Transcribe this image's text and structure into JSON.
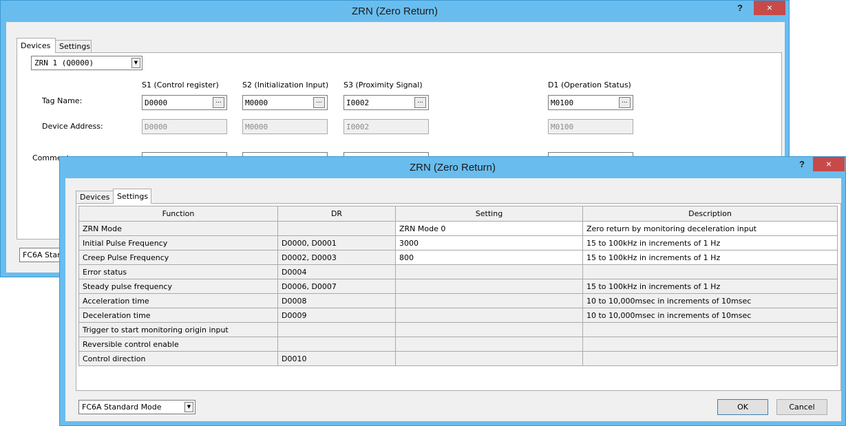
{
  "back_window": {
    "title": "ZRN (Zero Return)",
    "help_label": "?",
    "close_label": "×",
    "tabs": [
      {
        "label": "Devices"
      },
      {
        "label": "Settings"
      }
    ],
    "instance_select": "ZRN 1 (Q0000)",
    "columns": [
      "S1 (Control register)",
      "S2 (Initialization Input)",
      "S3 (Proximity Signal)",
      "D1 (Operation Status)"
    ],
    "row_labels": {
      "tag_name": "Tag Name:",
      "device_address": "Device Address:",
      "comment": "Comment:"
    },
    "tag_names": [
      "D0000",
      "M0000",
      "I0002",
      "M0100"
    ],
    "device_addresses": [
      "D0000",
      "M0000",
      "I0002",
      "M0100"
    ],
    "browse_label": "...",
    "mode_select": "FC6A Standard Mode"
  },
  "front_window": {
    "title": "ZRN (Zero Return)",
    "help_label": "?",
    "close_label": "×",
    "tabs": [
      {
        "label": "Devices"
      },
      {
        "label": "Settings"
      }
    ],
    "table": {
      "headers": [
        "Function",
        "DR",
        "Setting",
        "Description"
      ],
      "rows": [
        [
          "ZRN Mode",
          "",
          "ZRN Mode 0",
          "Zero return by monitoring deceleration input"
        ],
        [
          "Initial Pulse Frequency",
          "D0000, D0001",
          "3000",
          "15 to 100kHz in increments of 1 Hz"
        ],
        [
          "Creep Pulse Frequency",
          "D0002, D0003",
          "800",
          "15 to 100kHz in increments of 1 Hz"
        ],
        [
          "Error status",
          "D0004",
          "",
          ""
        ],
        [
          "Steady pulse frequency",
          "D0006, D0007",
          "",
          "15 to 100kHz in increments of 1 Hz"
        ],
        [
          "Acceleration time",
          "D0008",
          "",
          "10 to 10,000msec in increments of 10msec"
        ],
        [
          "Deceleration time",
          "D0009",
          "",
          "10 to 10,000msec in increments of 10msec"
        ],
        [
          "Trigger to start monitoring origin input",
          "",
          "",
          ""
        ],
        [
          "Reversible control enable",
          "",
          "",
          ""
        ],
        [
          "Control direction",
          "D0010",
          "",
          ""
        ]
      ]
    },
    "mode_select": "FC6A Standard Mode",
    "ok_label": "OK",
    "cancel_label": "Cancel"
  },
  "colors": {
    "title_bar": "#69bdee",
    "close_button": "#c74a4a",
    "client": "#f0f0f0"
  },
  "icons": {
    "close": "close-icon",
    "help": "help-icon",
    "dropdown": "chevron-down-icon",
    "browse": "ellipsis-icon"
  }
}
